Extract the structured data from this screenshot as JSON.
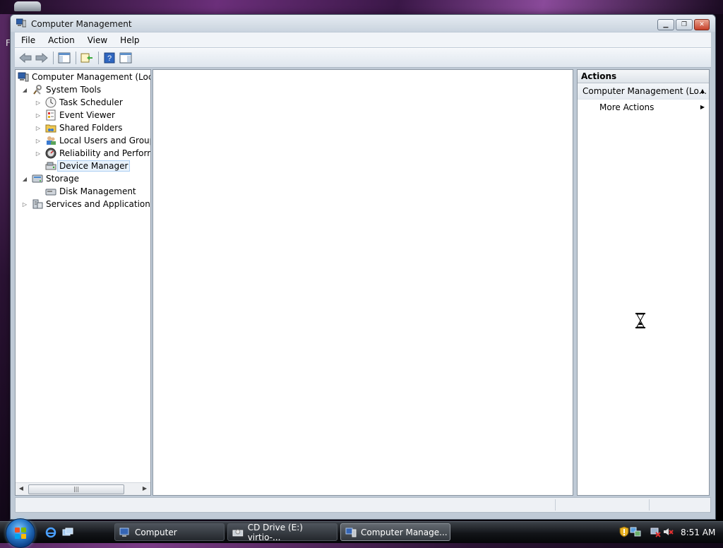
{
  "desktop": {
    "edge_letter": "F"
  },
  "window": {
    "title": "Computer Management",
    "buttons": {
      "minimize": "▁",
      "maximize": "❐",
      "close": "✕"
    }
  },
  "menu": {
    "file": "File",
    "action": "Action",
    "view": "View",
    "help": "Help"
  },
  "toolbar": {
    "items": [
      "back-icon",
      "forward-icon",
      "show-hide-console-tree-icon",
      "export-list-icon",
      "help-icon",
      "show-hide-action-pane-icon"
    ]
  },
  "tree": {
    "root": "Computer Management (Local",
    "system_tools": "System Tools",
    "task_scheduler": "Task Scheduler",
    "event_viewer": "Event Viewer",
    "shared_folders": "Shared Folders",
    "local_users": "Local Users and Groups",
    "reliability": "Reliability and Performa",
    "device_manager": "Device Manager",
    "storage": "Storage",
    "disk_management": "Disk Management",
    "services_apps": "Services and Applications",
    "selected": "Device Manager"
  },
  "actions": {
    "header": "Actions",
    "section_title": "Computer Management (Lo...",
    "more_actions": "More Actions"
  },
  "taskbar": {
    "buttons": [
      {
        "label": "Computer"
      },
      {
        "label": "CD Drive (E:) virtio-..."
      },
      {
        "label": "Computer Manage..."
      }
    ],
    "active_button": "Computer Manage...",
    "clock": "8:51 AM"
  },
  "colors": {
    "accent": "#3b79c6",
    "selection_bg": "#e8f2fc",
    "selection_border": "#aed0f3",
    "taskbar": "#121418"
  }
}
